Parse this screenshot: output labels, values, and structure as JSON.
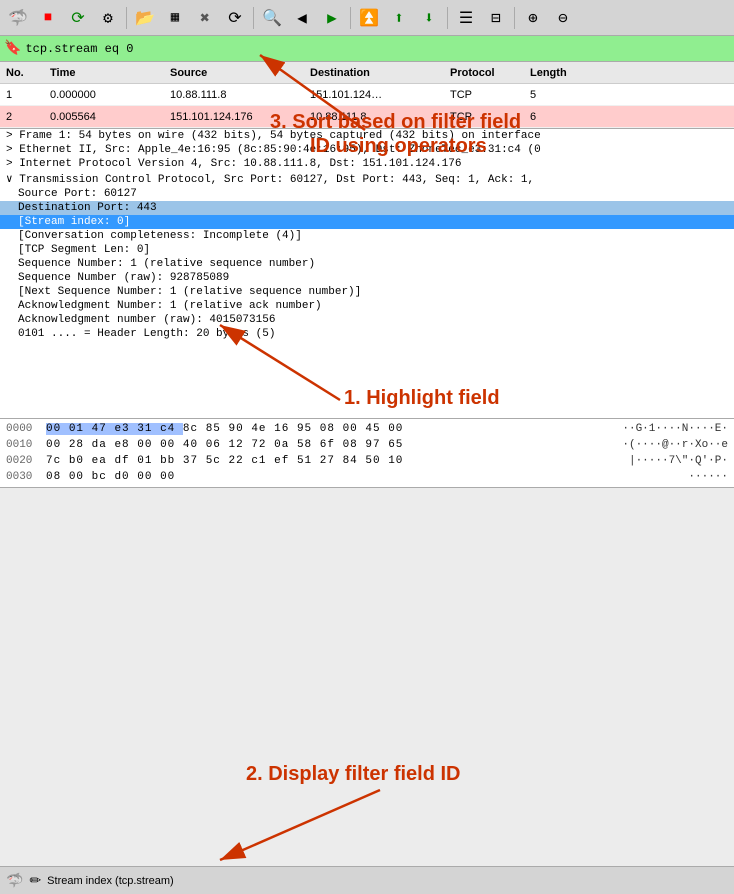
{
  "toolbar": {
    "icons": [
      {
        "name": "shark-icon",
        "symbol": "🦈"
      },
      {
        "name": "stop-icon",
        "symbol": "⏹"
      },
      {
        "name": "restart-icon",
        "symbol": "♻"
      },
      {
        "name": "settings-icon",
        "symbol": "⚙"
      },
      {
        "name": "open-icon",
        "symbol": "📂"
      },
      {
        "name": "grid-icon",
        "symbol": "▦"
      },
      {
        "name": "x-icon",
        "symbol": "✖"
      },
      {
        "name": "refresh-icon",
        "symbol": "⟳"
      },
      {
        "name": "search-icon",
        "symbol": "🔍"
      },
      {
        "name": "back-icon",
        "symbol": "←"
      },
      {
        "name": "forward-icon",
        "symbol": "→"
      },
      {
        "name": "jump-icon",
        "symbol": "↕"
      },
      {
        "name": "up-icon",
        "symbol": "⬆"
      },
      {
        "name": "down-icon",
        "symbol": "⬇"
      },
      {
        "name": "list-icon",
        "symbol": "☰"
      },
      {
        "name": "columns-icon",
        "symbol": "⊟"
      },
      {
        "name": "zoom-in-icon",
        "symbol": "🔎"
      },
      {
        "name": "zoom-out-icon",
        "symbol": "🔍"
      }
    ]
  },
  "filter": {
    "value": "tcp.stream eq 0"
  },
  "packet_list": {
    "headers": [
      "No.",
      "Time",
      "Source",
      "Destination",
      "Protocol",
      "Length"
    ],
    "rows": [
      {
        "no": "1",
        "time": "0.000000",
        "src": "10.88.111.8",
        "dst": "151.101.124…",
        "proto": "TCP",
        "len": "5",
        "selected": false,
        "red": false
      },
      {
        "no": "2",
        "time": "0.005564",
        "src": "151.101.124.176",
        "dst": "10.88.111.8",
        "proto": "TCP",
        "len": "6",
        "selected": false,
        "red": true
      }
    ]
  },
  "packet_details": [
    {
      "text": "Frame 1: 54 bytes on wire (432 bits), 54 bytes captured (432 bits) on interface",
      "indent": 0,
      "type": "collapsible",
      "selected": false,
      "highlighted": false
    },
    {
      "text": "Ethernet II, Src: Apple_4e:16:95 (8c:85:90:4e:16:95), Dst: ZhoneTec_e3:31:c4 (0",
      "indent": 0,
      "type": "collapsible",
      "selected": false,
      "highlighted": false
    },
    {
      "text": "Internet Protocol Version 4, Src: 10.88.111.8, Dst: 151.101.124.176",
      "indent": 0,
      "type": "collapsible",
      "selected": false,
      "highlighted": false
    },
    {
      "text": "Transmission Control Protocol, Src Port: 60127, Dst Port: 443, Seq: 1, Ack: 1,",
      "indent": 0,
      "type": "expanded",
      "selected": false,
      "highlighted": false
    },
    {
      "text": "Source Port: 60127",
      "indent": 1,
      "type": "none",
      "selected": false,
      "highlighted": false
    },
    {
      "text": "Destination Port: 443",
      "indent": 1,
      "type": "none",
      "selected": false,
      "highlighted": true
    },
    {
      "text": "[Stream index: 0]",
      "indent": 1,
      "type": "none",
      "selected": true,
      "highlighted": false
    },
    {
      "text": "[Conversation completeness: Incomplete (4)]",
      "indent": 1,
      "type": "none",
      "selected": false,
      "highlighted": false
    },
    {
      "text": "[TCP Segment Len: 0]",
      "indent": 1,
      "type": "none",
      "selected": false,
      "highlighted": false
    },
    {
      "text": "Sequence Number: 1    (relative sequence number)",
      "indent": 1,
      "type": "none",
      "selected": false,
      "highlighted": false
    },
    {
      "text": "Sequence Number (raw): 928785089",
      "indent": 1,
      "type": "none",
      "selected": false,
      "highlighted": false
    },
    {
      "text": "[Next Sequence Number: 1    (relative sequence number)]",
      "indent": 1,
      "type": "none",
      "selected": false,
      "highlighted": false
    },
    {
      "text": "Acknowledgment Number: 1    (relative ack number)",
      "indent": 1,
      "type": "none",
      "selected": false,
      "highlighted": false
    },
    {
      "text": "Acknowledgment number (raw): 4015073156",
      "indent": 1,
      "type": "none",
      "selected": false,
      "highlighted": false
    },
    {
      "text": "0101 .... = Header Length: 20 bytes (5)",
      "indent": 1,
      "type": "none",
      "selected": false,
      "highlighted": false
    }
  ],
  "hex_dump": [
    {
      "offset": "0000",
      "bytes_raw": "00 01 47 e3 31 c4 8c 85  90 4e 16 95 08 00 45 00",
      "hl_range": [
        0,
        5
      ],
      "ascii": "··G·1····N····E·"
    },
    {
      "offset": "0010",
      "bytes_raw": "00 28 da e8 00 00 40 06  12 72 0a 58 6f 08 97 65",
      "hl_range": [],
      "ascii": "·(····@··r·Xo··e"
    },
    {
      "offset": "0020",
      "bytes_raw": "7c b0 ea df 01 bb 37 5c  22 c1 ef 51 27 84 50 10",
      "hl_range": [],
      "ascii": "|·····7\\\"·Q'·P·"
    },
    {
      "offset": "0030",
      "bytes_raw": "08 00 bc d0 00 00",
      "hl_range": [],
      "ascii": "······"
    }
  ],
  "annotations": {
    "arrow1_label": "1. Highlight field",
    "arrow2_label": "2. Display filter field ID",
    "arrow3_label": "3. Sort based on filter field\n   ID using operators",
    "highlight_field_label": "Highlight field"
  },
  "status_bar": {
    "text": "Stream index (tcp.stream)"
  }
}
